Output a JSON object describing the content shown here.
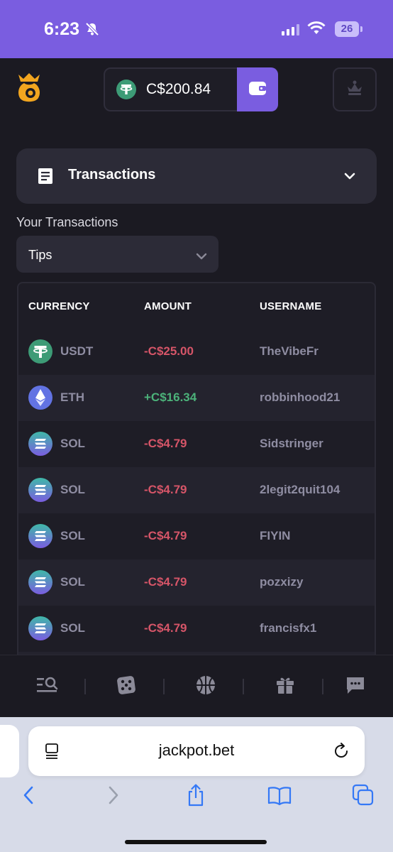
{
  "status_bar": {
    "time": "6:23",
    "battery": "26"
  },
  "header": {
    "balance": "C$200.84",
    "wallet_icon": "wallet-icon",
    "profile_icon": "crown-icon"
  },
  "transactions_card": {
    "title": "Transactions",
    "icon": "document-icon"
  },
  "filter": {
    "label": "Your Transactions",
    "selected": "Tips"
  },
  "table": {
    "headers": [
      "CURRENCY",
      "AMOUNT",
      "USERNAME"
    ],
    "rows": [
      {
        "currency": "USDT",
        "amount": "-C$25.00",
        "username": "TheVibeFr",
        "sign": "neg"
      },
      {
        "currency": "ETH",
        "amount": "+C$16.34",
        "username": "robbinhood21",
        "sign": "pos"
      },
      {
        "currency": "SOL",
        "amount": "-C$4.79",
        "username": "Sidstringer",
        "sign": "neg"
      },
      {
        "currency": "SOL",
        "amount": "-C$4.79",
        "username": "2legit2quit104",
        "sign": "neg"
      },
      {
        "currency": "SOL",
        "amount": "-C$4.79",
        "username": "FIYIN",
        "sign": "neg"
      },
      {
        "currency": "SOL",
        "amount": "-C$4.79",
        "username": "pozxizy",
        "sign": "neg"
      },
      {
        "currency": "SOL",
        "amount": "-C$4.79",
        "username": "francisfx1",
        "sign": "neg"
      }
    ]
  },
  "bottom_nav": [
    "search-menu-icon",
    "dice-icon",
    "basketball-icon",
    "gift-icon",
    "chat-icon"
  ],
  "browser": {
    "url": "jackpot.bet"
  },
  "colors": {
    "accent": "#7a5de0",
    "negative": "#d65568",
    "positive": "#4cb27a",
    "background": "#1b1a22"
  }
}
